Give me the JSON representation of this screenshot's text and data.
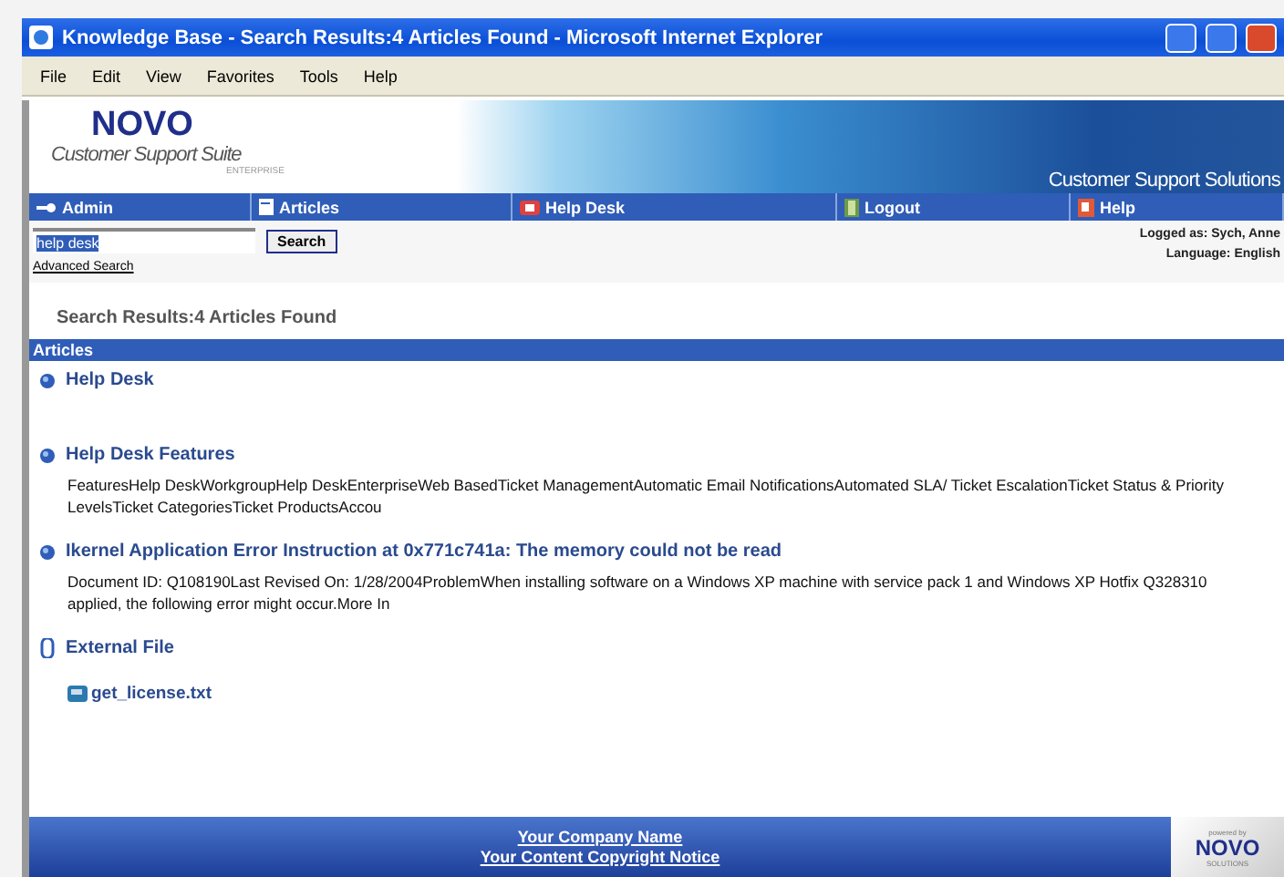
{
  "window": {
    "title": "Knowledge Base - Search Results:4 Articles Found - Microsoft Internet Explorer"
  },
  "menu": [
    "File",
    "Edit",
    "View",
    "Favorites",
    "Tools",
    "Help"
  ],
  "banner": {
    "logo": "NOVO",
    "product": "Customer Support Suite",
    "edition": "ENTERPRISE",
    "tagline": "Customer Support Solutions"
  },
  "nav": [
    {
      "label": "Admin",
      "kind": "key"
    },
    {
      "label": "Articles",
      "kind": "doc"
    },
    {
      "label": "Help Desk",
      "kind": "phone"
    },
    {
      "label": "Logout",
      "kind": "door"
    },
    {
      "label": "Help",
      "kind": "book"
    }
  ],
  "search": {
    "value": "help desk",
    "button": "Search",
    "advanced": "Advanced Search"
  },
  "session": {
    "user": "Logged as: Sych, Anne",
    "language": "Language: English"
  },
  "results_heading": "Search Results:4 Articles Found",
  "section": "Articles",
  "results": [
    {
      "kind": "article",
      "title": "Help Desk"
    },
    {
      "kind": "article",
      "title": "Help Desk Features",
      "summary": "FeaturesHelp DeskWorkgroupHelp DeskEnterpriseWeb BasedTicket ManagementAutomatic Email NotificationsAutomated SLA/ Ticket EscalationTicket Status & Priority LevelsTicket CategoriesTicket ProductsAccou"
    },
    {
      "kind": "article",
      "title": "Ikernel Application Error Instruction at 0x771c741a: The memory could not be read",
      "summary": "Document ID: Q108190Last Revised On: 1/28/2004ProblemWhen installing software on a Windows XP machine with service pack 1 and Windows XP Hotfix Q328310 applied, the following error might occur.More In"
    },
    {
      "kind": "external",
      "title": "External File",
      "file": "get_license.txt"
    }
  ],
  "footer": {
    "company": "Your Company Name",
    "copyright": "Your Content Copyright Notice",
    "powered": "powered by",
    "logo": "NOVO",
    "logo_sub": "SOLUTIONS"
  }
}
